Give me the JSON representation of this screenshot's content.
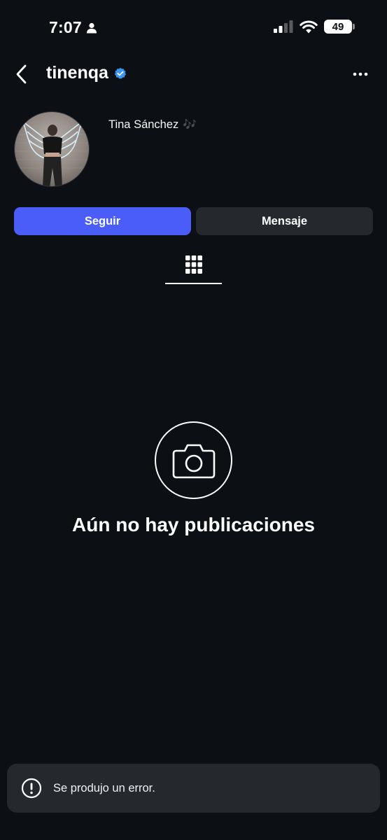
{
  "status_bar": {
    "time": "7:07",
    "battery": "49"
  },
  "header": {
    "username": "tinenqa",
    "verified": true
  },
  "profile": {
    "display_name": "Tina Sánchez",
    "name_emoji": "🎶"
  },
  "actions": {
    "follow_label": "Seguir",
    "message_label": "Mensaje"
  },
  "tabs": {
    "active": "grid-icon"
  },
  "empty_state": {
    "icon": "camera-icon",
    "title": "Aún no hay publicaciones"
  },
  "toast": {
    "icon": "alert-circle-icon",
    "message": "Se produjo un error."
  },
  "colors": {
    "background": "#0c1014",
    "accent": "#4a5df9",
    "secondary_button": "#25292e",
    "verified_badge": "#3897f0"
  }
}
